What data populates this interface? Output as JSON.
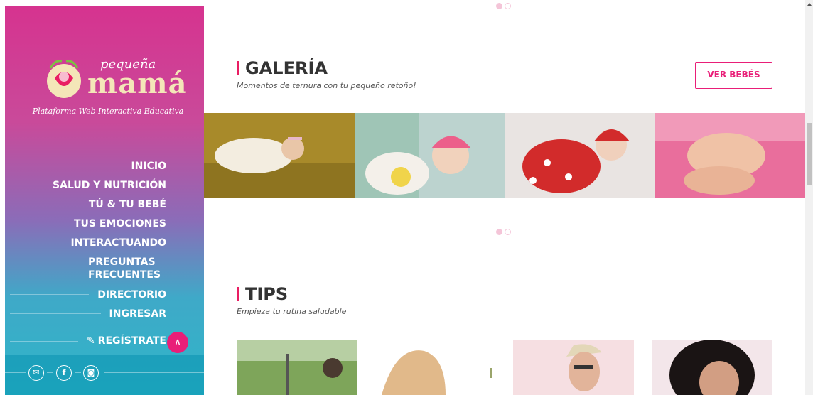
{
  "brand": {
    "name_top": "pequeña",
    "name_main": "mamá",
    "tagline": "Plataforma Web Interactiva Educativa"
  },
  "nav": {
    "items": [
      {
        "label": "INICIO"
      },
      {
        "label": "SALUD Y NUTRICIÓN"
      },
      {
        "label": "TÚ & TU BEBÉ"
      },
      {
        "label": "TUS EMOCIONES"
      },
      {
        "label": "INTERACTUANDO"
      },
      {
        "label": "PREGUNTAS FRECUENTES"
      },
      {
        "label": "DIRECTORIO"
      },
      {
        "label": "INGRESAR"
      }
    ],
    "register_label": "REGÍSTRATE",
    "register_icon": "edit-icon"
  },
  "social": [
    "email-icon",
    "facebook-icon",
    "instagram-icon"
  ],
  "galeria": {
    "title": "GALERÍA",
    "subtitle": "Momentos de ternura con tu pequeño retoño!",
    "button": "VER BEBÉS",
    "images": [
      "baby-in-white-dress",
      "baby-in-pink-hat",
      "baby-in-red-costume",
      "baby-feet"
    ]
  },
  "tips": {
    "title": "TIPS",
    "subtitle": "Empieza tu rutina saludable",
    "images": [
      "woman-in-park",
      "woman-in-sports-top",
      "woman-with-hat",
      "woman-portrait"
    ]
  },
  "colors": {
    "accent": "#e91e78",
    "sidebar_top": "#d6338f",
    "sidebar_bottom": "#2fb5c9"
  }
}
